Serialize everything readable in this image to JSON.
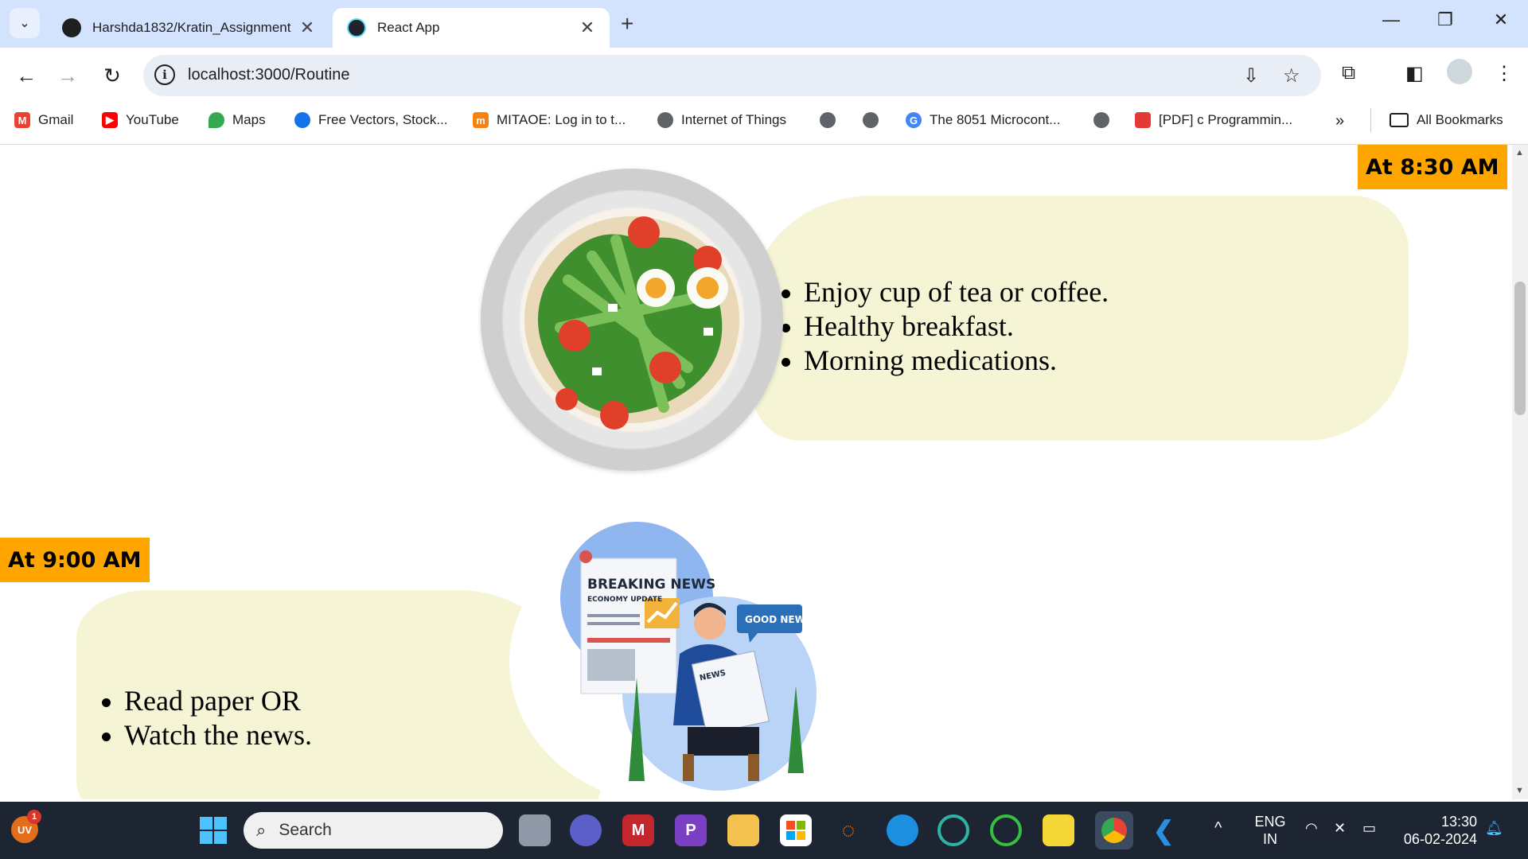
{
  "browser": {
    "tabs": [
      {
        "title": "Harshda1832/Kratin_Assignment",
        "active": false
      },
      {
        "title": "React App",
        "active": true
      }
    ],
    "url": "localhost:3000/Routine",
    "bookmarks": [
      {
        "label": "Gmail",
        "icon": "gmail-icon",
        "color": "#ea4335"
      },
      {
        "label": "YouTube",
        "icon": "youtube-icon",
        "color": "#ff0000"
      },
      {
        "label": "Maps",
        "icon": "maps-icon",
        "color": "#34a853"
      },
      {
        "label": "Free Vectors, Stock...",
        "icon": "freepik-icon",
        "color": "#1273eb"
      },
      {
        "label": "MITAOE: Log in to t...",
        "icon": "moodle-icon",
        "color": "#f98012"
      },
      {
        "label": "Internet of Things",
        "icon": "globe-icon",
        "color": "#5f6368"
      },
      {
        "label": "",
        "icon": "globe-icon",
        "color": "#5f6368"
      },
      {
        "label": "",
        "icon": "globe-icon",
        "color": "#5f6368"
      },
      {
        "label": "The 8051 Microcont...",
        "icon": "google-icon",
        "color": "#4285f4"
      },
      {
        "label": "",
        "icon": "globe-icon",
        "color": "#5f6368"
      },
      {
        "label": "[PDF] c Programmin...",
        "icon": "pdf-bookmark-icon",
        "color": "#e53935"
      }
    ],
    "all_bookmarks": "All Bookmarks"
  },
  "page": {
    "sections": [
      {
        "time": "At 8:30 AM",
        "image": "breakfast-plate-image",
        "items": [
          "Enjoy cup of tea or coffee.",
          "Healthy breakfast.",
          "Morning medications."
        ]
      },
      {
        "time": "At 9:00 AM",
        "image": "reading-news-image",
        "items": [
          "Read paper OR",
          "Watch the news."
        ]
      }
    ],
    "newspaper_headline": "BREAKING NEWS",
    "newspaper_sub": "ECONOMY UPDATE",
    "speech_bubble": "GOOD NEWS",
    "paper_label": "NEWS"
  },
  "taskbar": {
    "search_label": "Search",
    "user_initials": "UV",
    "notification_count": "1",
    "lang_top": "ENG",
    "lang_bottom": "IN",
    "time": "13:30",
    "date": "06-02-2024"
  }
}
